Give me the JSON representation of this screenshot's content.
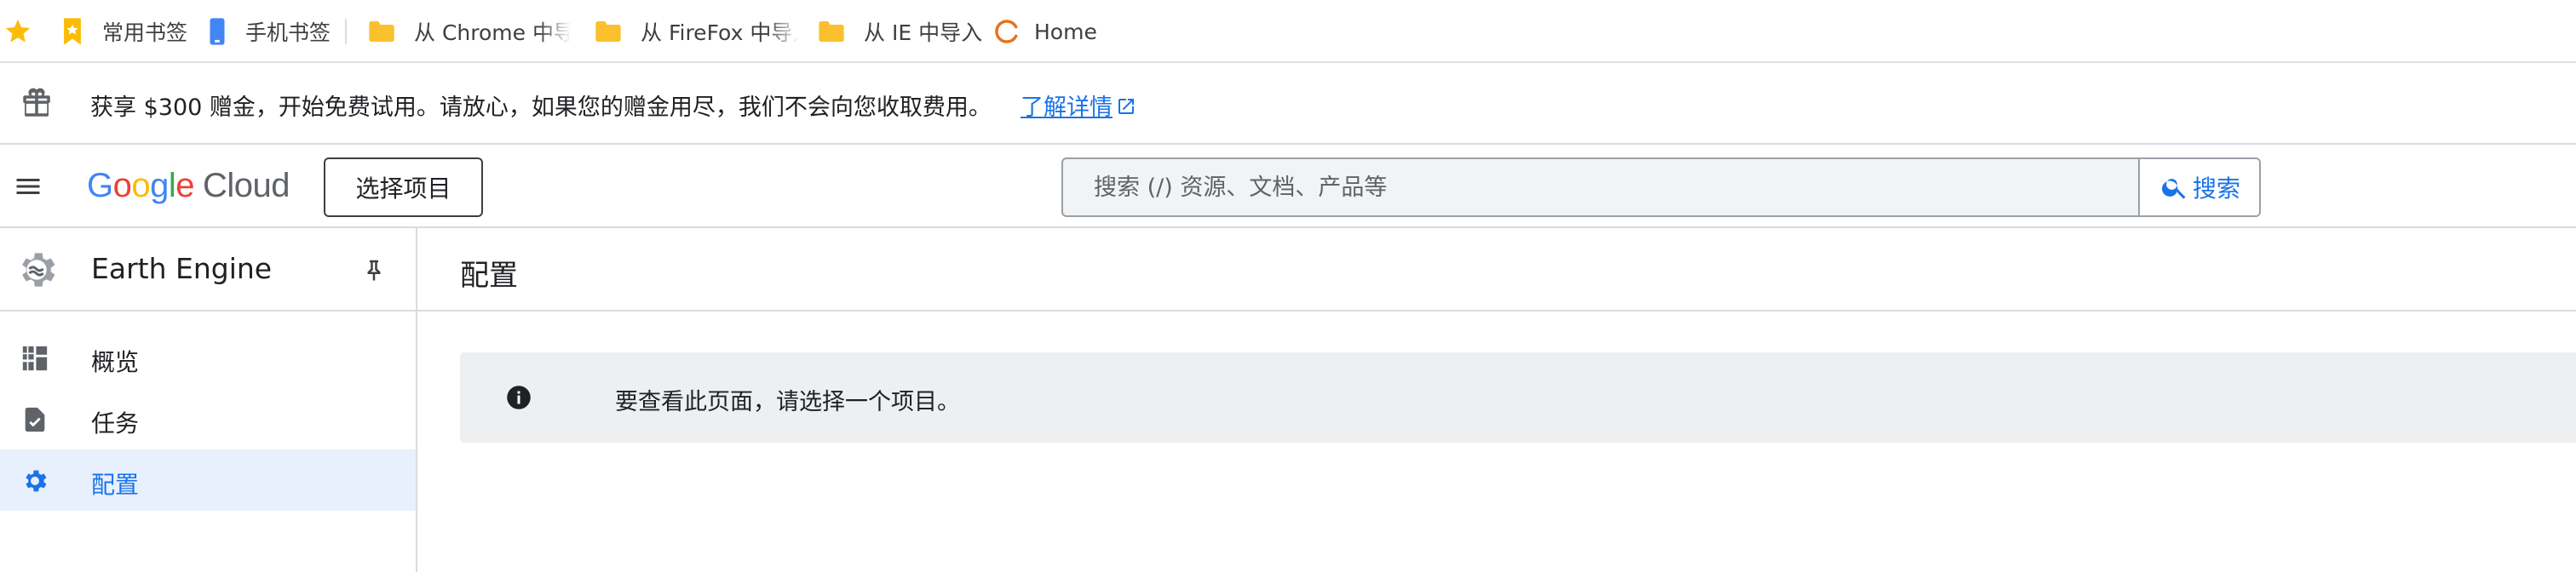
{
  "bookmarks": {
    "items": [
      {
        "label": "常用书签"
      },
      {
        "label": "手机书签"
      },
      {
        "label": "从 Chrome 中导入"
      },
      {
        "label": "从 FireFox 中导入"
      },
      {
        "label": "从 IE 中导入"
      },
      {
        "label": "Home"
      }
    ]
  },
  "banner": {
    "text": "获享 $300 赠金，开始免费试用。请放心，如果您的赠金用尽，我们不会向您收取费用。",
    "link": "了解详情"
  },
  "header": {
    "logo_google": [
      "G",
      "o",
      "o",
      "g",
      "l",
      "e"
    ],
    "logo_cloud": "Cloud",
    "project_button": "选择项目",
    "search_placeholder": "搜索 (/) 资源、文档、产品等",
    "search_button": "搜索"
  },
  "sidebar": {
    "title": "Earth Engine",
    "items": [
      {
        "label": "概览",
        "icon": "dashboard-icon",
        "active": false
      },
      {
        "label": "任务",
        "icon": "task-icon",
        "active": false
      },
      {
        "label": "配置",
        "icon": "gear-icon",
        "active": true
      }
    ]
  },
  "main": {
    "title": "配置",
    "notice": "要查看此页面，请选择一个项目。"
  },
  "colors": {
    "accent": "#1a73e8",
    "active_bg": "#e8f0fe",
    "notice_bg": "#eeeff1",
    "star": "#fbbc04",
    "folder": "#fbc02d"
  }
}
